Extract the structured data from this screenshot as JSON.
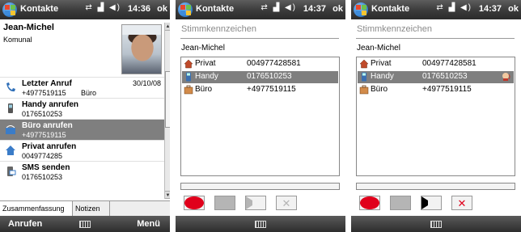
{
  "colors": {
    "selection": "#7f7f7f",
    "record_red": "#e0001b",
    "disabled_gray": "#b5b5b5"
  },
  "screen1": {
    "app_title": "Kontakte",
    "time": "14:36",
    "ok": "ok",
    "contact_name": "Jean-Michel",
    "company": "Komunal",
    "rows": [
      {
        "title": "Letzter Anruf",
        "date": "30/10/08",
        "sub": "+4977519115",
        "extra": "Büro",
        "icon": "phone-log-icon"
      },
      {
        "title": "Handy anrufen",
        "sub": "0176510253",
        "icon": "mobile-phone-icon"
      },
      {
        "title": "Büro anrufen",
        "sub": "+4977519115",
        "icon": "office-phone-icon"
      },
      {
        "title": "Privat anrufen",
        "sub": "0049774285",
        "icon": "home-phone-icon"
      },
      {
        "title": "SMS senden",
        "sub": "0176510253",
        "icon": "sms-icon"
      }
    ],
    "tabs": [
      "Zusammenfassung",
      "Notizen"
    ],
    "softkey_left": "Anrufen",
    "softkey_right": "Menü"
  },
  "screen2": {
    "app_title": "Kontakte",
    "time": "14:37",
    "ok": "ok",
    "heading": "Stimmkennzeichen",
    "name": "Jean-Michel",
    "entries": [
      {
        "label": "Privat",
        "number": "004977428581",
        "icon": "home-icon"
      },
      {
        "label": "Handy",
        "number": "0176510253",
        "icon": "mobile-icon"
      },
      {
        "label": "Büro",
        "number": "+4977519115",
        "icon": "office-icon"
      }
    ]
  },
  "screen3": {
    "app_title": "Kontakte",
    "time": "14:37",
    "ok": "ok",
    "heading": "Stimmkennzeichen",
    "name": "Jean-Michel",
    "entries": [
      {
        "label": "Privat",
        "number": "004977428581",
        "icon": "home-icon"
      },
      {
        "label": "Handy",
        "number": "0176510253",
        "icon": "mobile-icon"
      },
      {
        "label": "Büro",
        "number": "+4977519115",
        "icon": "office-icon"
      }
    ]
  }
}
